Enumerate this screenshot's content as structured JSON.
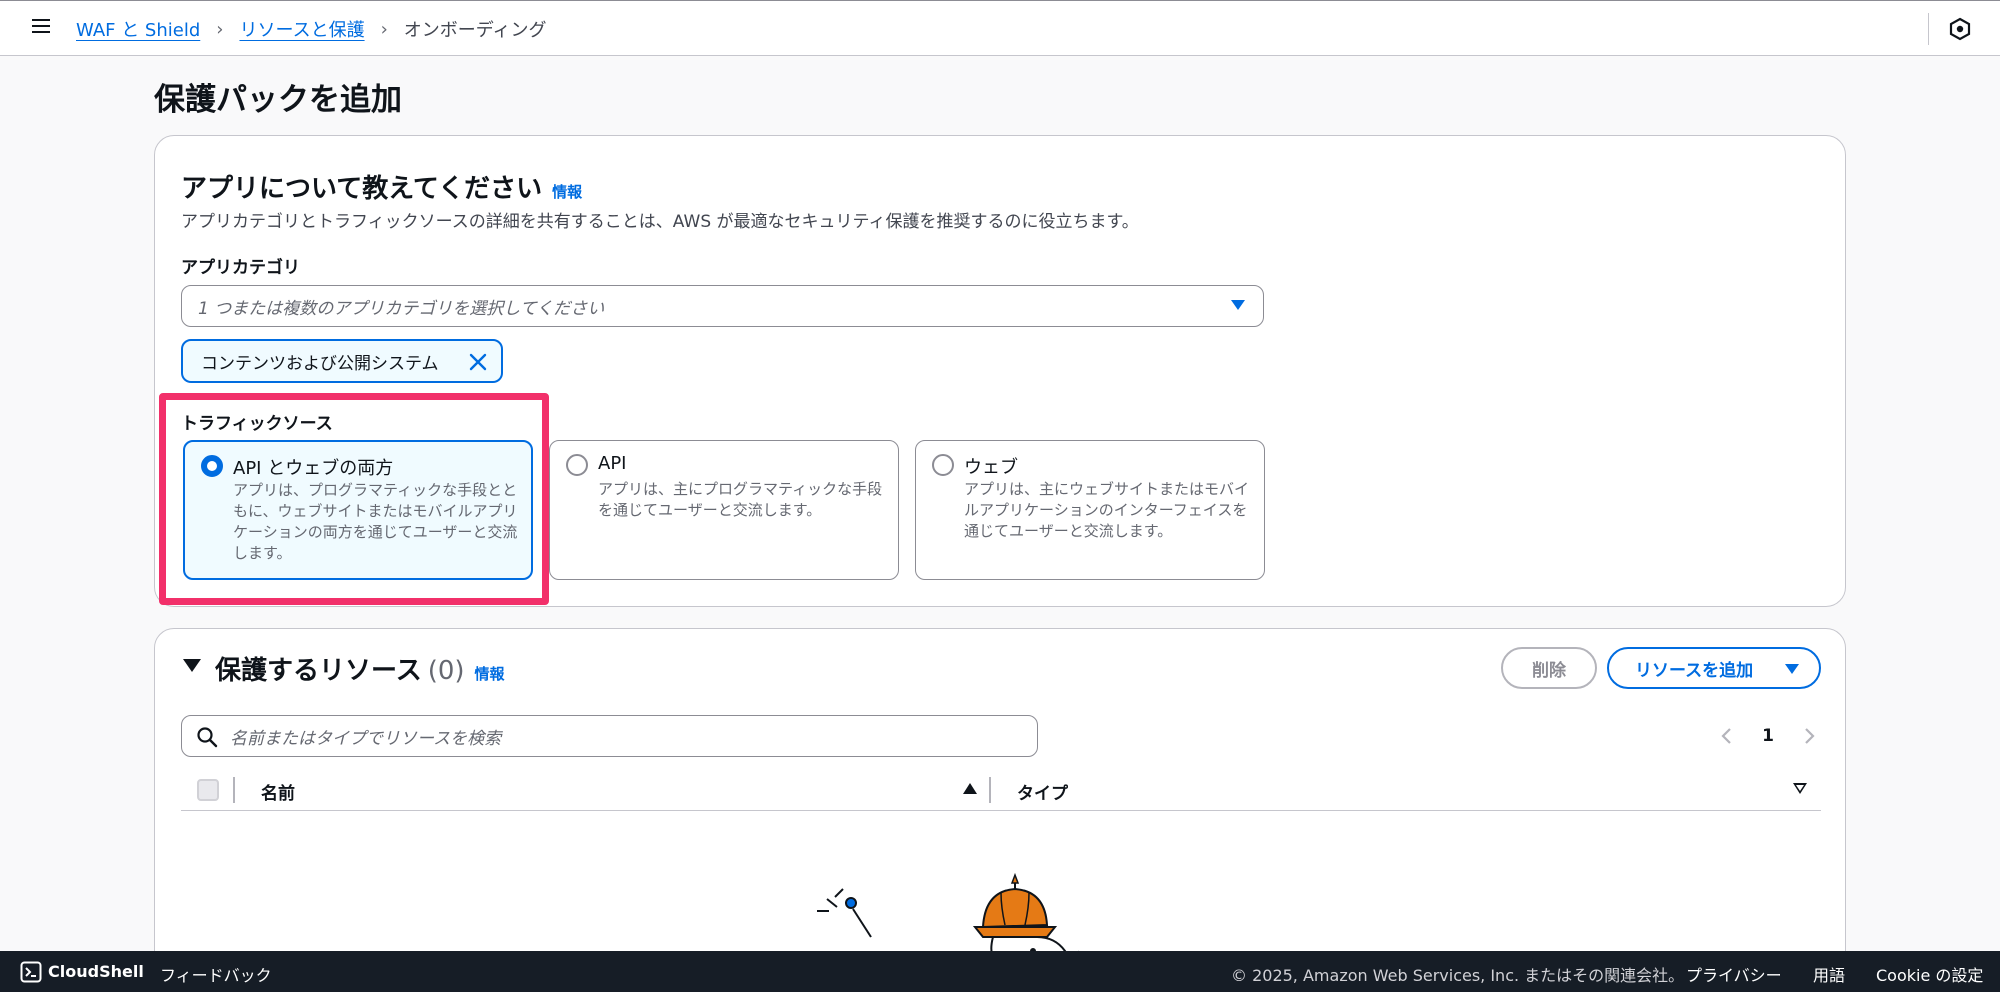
{
  "breadcrumb": {
    "items": [
      "WAF と Shield",
      "リソースと保護"
    ],
    "current": "オンボーディング"
  },
  "page": {
    "title": "保護パックを追加"
  },
  "app_section": {
    "title": "アプリについて教えてください",
    "info": "情報",
    "description": "アプリカテゴリとトラフィックソースの詳細を共有することは、AWS が最適なセキュリティ保護を推奨するのに役立ちます。",
    "category_label": "アプリカテゴリ",
    "category_placeholder": "1 つまたは複数のアプリカテゴリを選択してください",
    "selected_token": "コンテンツおよび公開システム",
    "traffic_label": "トラフィックソース",
    "traffic_options": [
      {
        "title": "API とウェブの両方",
        "desc": "アプリは、プログラマティックな手段とともに、ウェブサイトまたはモバイルアプリケーションの両方を通じてユーザーと交流します。",
        "selected": true
      },
      {
        "title": "API",
        "desc": "アプリは、主にプログラマティックな手段を通じてユーザーと交流します。",
        "selected": false
      },
      {
        "title": "ウェブ",
        "desc": "アプリは、主にウェブサイトまたはモバイルアプリケーションのインターフェイスを通じてユーザーと交流します。",
        "selected": false
      }
    ]
  },
  "resources_section": {
    "title": "保護するリソース",
    "count": "(0)",
    "info": "情報",
    "delete_label": "削除",
    "add_label": "リソースを追加",
    "search_placeholder": "名前またはタイプでリソースを検索",
    "page_number": "1",
    "columns": [
      "名前",
      "タイプ"
    ]
  },
  "footer": {
    "cloudshell": "CloudShell",
    "feedback": "フィードバック",
    "copyright": "© 2025, Amazon Web Services, Inc. またはその関連会社。",
    "privacy": "プライバシー",
    "terms": "用語",
    "cookie": "Cookie の設定"
  },
  "colors": {
    "accent": "#006ce0",
    "highlight": "#f2306a",
    "footer_bg": "#161d26"
  }
}
